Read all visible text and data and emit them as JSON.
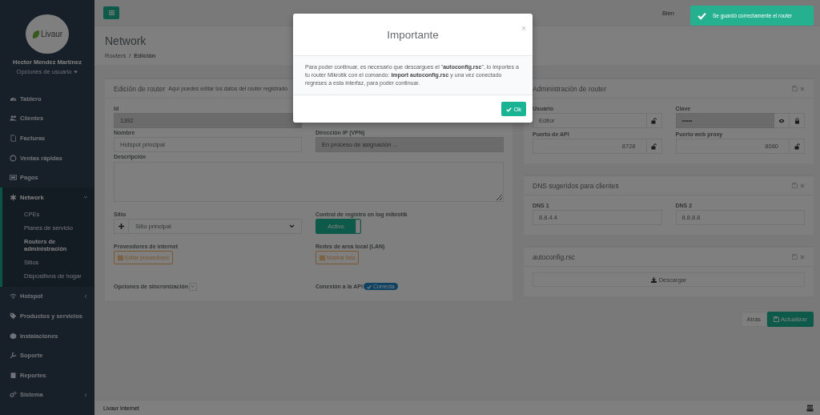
{
  "sidebar": {
    "logo": "Livaur",
    "user_name": "Hector Mendez Martínez",
    "user_menu": "Opciones de usuario",
    "items": [
      {
        "label": "Tablero",
        "selected": false
      },
      {
        "label": "Clientes",
        "selected": false
      },
      {
        "label": "Facturas",
        "selected": false
      },
      {
        "label": "Ventas rápidas",
        "selected": false
      },
      {
        "label": "Pagos",
        "selected": false
      },
      {
        "label": "Network",
        "selected": true,
        "expanded": true,
        "children": [
          {
            "label": "CPEs",
            "selected": false
          },
          {
            "label": "Planes de servicio",
            "selected": false
          },
          {
            "label": "Routers de administración",
            "selected": true
          },
          {
            "label": "Sitios",
            "selected": false
          },
          {
            "label": "Dispositivos de hogar",
            "selected": false
          }
        ]
      },
      {
        "label": "Hotspot",
        "selected": false,
        "expanded": false
      },
      {
        "label": "Productos y servicios",
        "selected": false
      },
      {
        "label": "Instalaciones",
        "selected": false
      },
      {
        "label": "Soporte",
        "selected": false
      },
      {
        "label": "Reportes",
        "selected": false
      },
      {
        "label": "Sistema",
        "selected": false,
        "expanded": false
      }
    ]
  },
  "topbar": {
    "welcome": "Bien"
  },
  "page": {
    "title": "Network",
    "breadcrumb_separator": "/",
    "breadcrumb": [
      {
        "label": "Routers",
        "selected": false
      },
      {
        "label": "Edición",
        "selected": true
      }
    ]
  },
  "router_form": {
    "title": "Edición de router",
    "subtitle": "Aquí puedes editar los datos del router registrado",
    "id_field": {
      "label": "Id",
      "value": "1392",
      "disabled": true
    },
    "name_field": {
      "label": "Nombre",
      "value": "Hotspot principal",
      "disabled": false
    },
    "ip_field": {
      "label": "Dirección IP (VPN)",
      "value": "En proceso de asignación ...",
      "disabled": true
    },
    "description": {
      "label": "Descripción"
    },
    "site": {
      "label": "Sitio",
      "value": "Sitio principal"
    },
    "log_control": {
      "label": "Control de registro en log mikrotik",
      "toggle_label": "Activo",
      "on": true
    },
    "providers": {
      "label": "Proveedores de internet",
      "button": "Editar proveedores"
    },
    "lan": {
      "label": "Redes de area local (LAN)",
      "button": "Mostrar lista"
    },
    "sync": {
      "label": "Opciones de sincronización",
      "expanded": false
    },
    "api": {
      "label": "Conexión a la API",
      "badge": "Correcta"
    }
  },
  "admin_panel": {
    "title": "Administración de router",
    "fields": [
      {
        "label": "Usuario",
        "value": "Editor",
        "kind": "text",
        "locked": false,
        "disabled": false
      },
      {
        "label": "Clave",
        "value": "•••••",
        "kind": "password",
        "locked": true,
        "disabled": true
      },
      {
        "label": "Puerto de API",
        "value": "8728",
        "kind": "number",
        "locked": false,
        "disabled": false
      },
      {
        "label": "Puerto web proxy",
        "value": "8080",
        "kind": "number",
        "locked": false,
        "disabled": false
      }
    ]
  },
  "dns_panel": {
    "title": "DNS sugeridos para clientes",
    "fields": [
      {
        "label": "DNS 1",
        "value": "8.8.4.4"
      },
      {
        "label": "DNS 2",
        "value": "8.8.8.8"
      }
    ]
  },
  "autoconfig_panel": {
    "title": "autoconfig.rsc",
    "button": "Descargar"
  },
  "actions": [
    {
      "label": "Atrás",
      "kind": "default"
    },
    {
      "label": "Actualizar",
      "kind": "primary"
    }
  ],
  "footer": {
    "text": "Livaur Internet"
  },
  "modal": {
    "title": "Importante",
    "close": "×",
    "body": "Para poder continuar, es necesario que descargues el \"**autoconfig.rsc**\", lo importes a tu router Mikrotik con el comando: **import autoconfig.rsc** y una vez conectado regreses a esta interfaz, para poder continuar.",
    "button": "Ok"
  },
  "toast": {
    "message": "Se guardó correctamente el router"
  }
}
